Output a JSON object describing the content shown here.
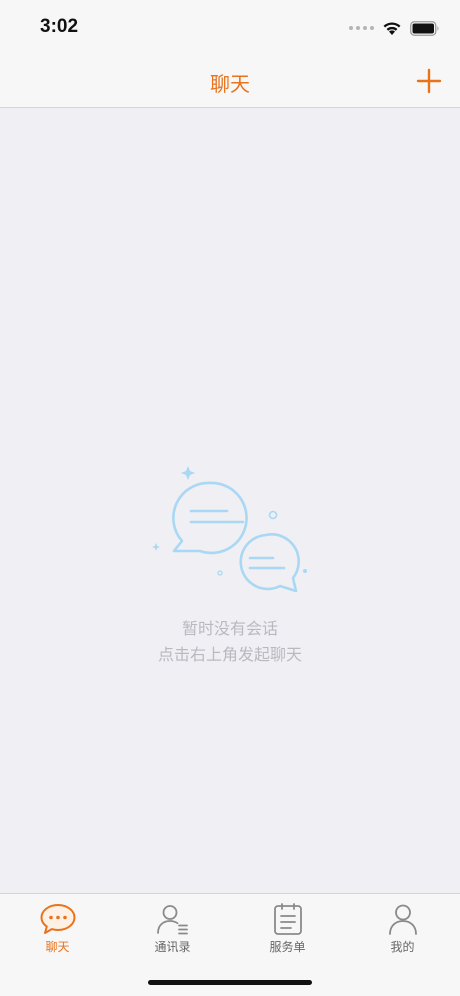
{
  "status_bar": {
    "time": "3:02"
  },
  "nav": {
    "title": "聊天"
  },
  "empty_state": {
    "line1": "暂时没有会话",
    "line2": "点击右上角发起聊天"
  },
  "tabs": [
    {
      "label": "聊天",
      "icon": "chat-bubble-icon",
      "active": true
    },
    {
      "label": "通讯录",
      "icon": "contacts-icon",
      "active": false
    },
    {
      "label": "服务单",
      "icon": "service-order-icon",
      "active": false
    },
    {
      "label": "我的",
      "icon": "profile-icon",
      "active": false
    }
  ],
  "colors": {
    "accent": "#e8731d",
    "illustration": "#a9d8f5",
    "inactive": "#8a8a8a"
  }
}
